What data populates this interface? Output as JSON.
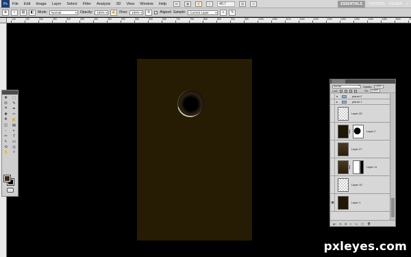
{
  "menubar": {
    "logo": "Ps",
    "items": [
      "File",
      "Edit",
      "Image",
      "Layer",
      "Select",
      "Filter",
      "Analysis",
      "3D",
      "View",
      "Window",
      "Help"
    ],
    "zoom": "40.7",
    "workspaces": {
      "active": "ESSENTIALS",
      "others": [
        "PAINTING",
        "DESIGN"
      ],
      "more": "»"
    }
  },
  "options": {
    "mode_label": "Mode:",
    "mode_value": "Normal",
    "opacity_label": "Opacity:",
    "opacity_value": "100%",
    "flow_label": "Flow:",
    "flow_value": "100%",
    "aligned_label": "Aligned",
    "sample_label": "Sample:",
    "sample_value": "Current Layer"
  },
  "ruler": {
    "labels": [
      "100",
      "150",
      "200",
      "250",
      "300",
      "350",
      "400",
      "450",
      "500",
      "550",
      "600",
      "650",
      "700",
      "750",
      "800",
      "850",
      "900",
      "950",
      "1000",
      "1050",
      "1100",
      "1150",
      "1200",
      "1250",
      "1300",
      "1350",
      "1400",
      "1450",
      "1500",
      "1550"
    ]
  },
  "canvas": {
    "fill": "#261b03"
  },
  "tools": {
    "icons": [
      "move-icon",
      "marquee-icon",
      "lasso-icon",
      "quick-select-icon",
      "crop-icon",
      "eyedropper-icon",
      "healing-icon",
      "brush-icon",
      "clone-stamp-icon",
      "history-brush-icon",
      "eraser-icon",
      "gradient-icon",
      "blur-icon",
      "dodge-icon",
      "pen-icon",
      "type-icon",
      "path-select-icon",
      "shape-icon",
      "3d-rotate-icon",
      "3d-orbit-icon",
      "hand-icon",
      "zoom-icon"
    ],
    "glyphs": [
      "✥",
      "⬚",
      "ʘ",
      "✎",
      "⌗",
      "✒",
      "✚",
      "✏",
      "⎈",
      "✍",
      "◫",
      "▤",
      "◌",
      "◐",
      "✑",
      "T",
      "↖",
      "▭",
      "⟲",
      "◎",
      "✋",
      "⌕"
    ],
    "foreground_color": "#3a2a14",
    "background_color": "#000000"
  },
  "layers": {
    "blend_mode": "Normal",
    "opacity_label": "Opacity:",
    "opacity_value": "100%",
    "fill_label": "Fill:",
    "fill_value": "100%",
    "lock_label": "Lock:",
    "rows": [
      {
        "type": "group",
        "name": "planet 2",
        "expanded": true
      },
      {
        "type": "group",
        "name": "planet 1",
        "expanded": false
      },
      {
        "type": "layer",
        "name": "Layer 25",
        "thumb": "checker",
        "mask": false
      },
      {
        "type": "layer",
        "name": "Layer 2",
        "thumb": "dark",
        "mask": true
      },
      {
        "type": "layer",
        "name": "Layer 27",
        "thumb": "gradient",
        "mask": false
      },
      {
        "type": "layer",
        "name": "Layer 11",
        "thumb": "gradient",
        "mask": true
      },
      {
        "type": "layer",
        "name": "Layer 10",
        "thumb": "checker",
        "mask": false
      },
      {
        "type": "layer",
        "name": "Layer 1",
        "thumb": "dark",
        "mask": false,
        "visible": true
      }
    ],
    "footer": [
      "go",
      "fx",
      "◘",
      "◐",
      "▭",
      "▢",
      "🗑"
    ]
  },
  "watermark": "pxleyes.com"
}
